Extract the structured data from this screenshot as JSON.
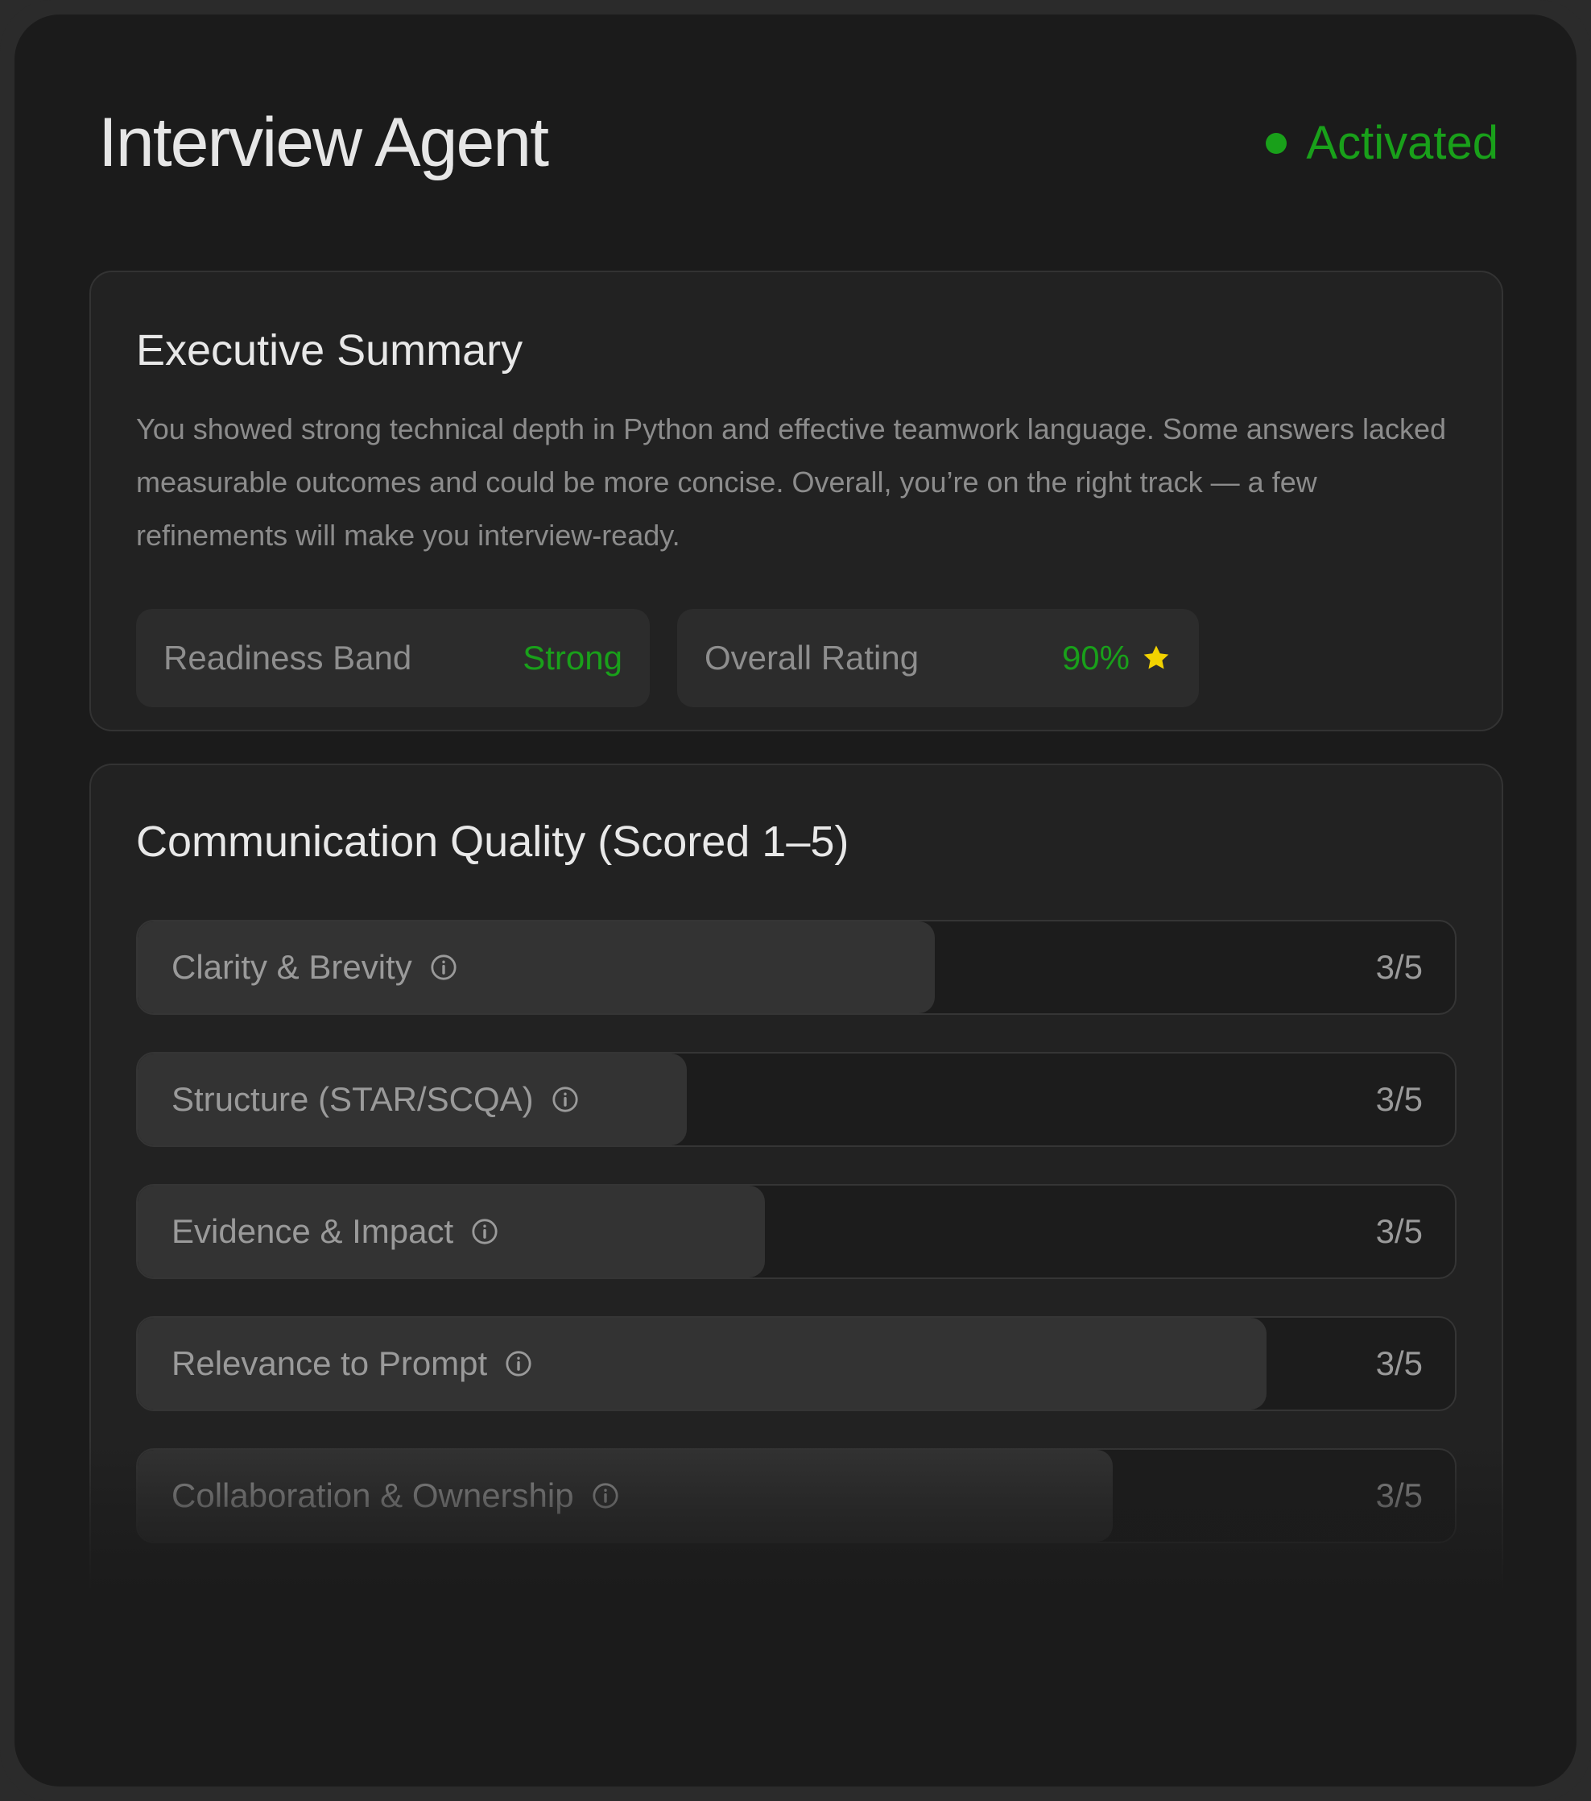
{
  "header": {
    "title": "Interview Agent",
    "status": "Activated",
    "status_color": "#19a01a"
  },
  "summary": {
    "title": "Executive Summary",
    "body": "You showed strong technical depth in Python and effective teamwork language. Some answers lacked measurable outcomes and could be more concise. Overall, you’re on the right track — a few refinements will make you interview-ready.",
    "readiness": {
      "label": "Readiness Band",
      "value": "Strong"
    },
    "rating": {
      "label": "Overall Rating",
      "value": "90%",
      "icon": "star-icon",
      "icon_color": "#f2d200"
    }
  },
  "communication": {
    "title": "Communication Quality (Scored 1–5)",
    "metrics": [
      {
        "label": "Clarity & Brevity",
        "score": "3/5",
        "fill_fraction": 0.605,
        "icon": "info-icon"
      },
      {
        "label": "Structure (STAR/SCQA)",
        "score": "3/5",
        "fill_fraction": 0.417,
        "icon": "info-icon"
      },
      {
        "label": "Evidence & Impact",
        "score": "3/5",
        "fill_fraction": 0.476,
        "icon": "info-icon"
      },
      {
        "label": "Relevance to Prompt",
        "score": "3/5",
        "fill_fraction": 0.857,
        "icon": "info-icon"
      },
      {
        "label": "Collaboration & Ownership",
        "score": "3/5",
        "fill_fraction": 0.74,
        "icon": "info-icon"
      }
    ]
  }
}
